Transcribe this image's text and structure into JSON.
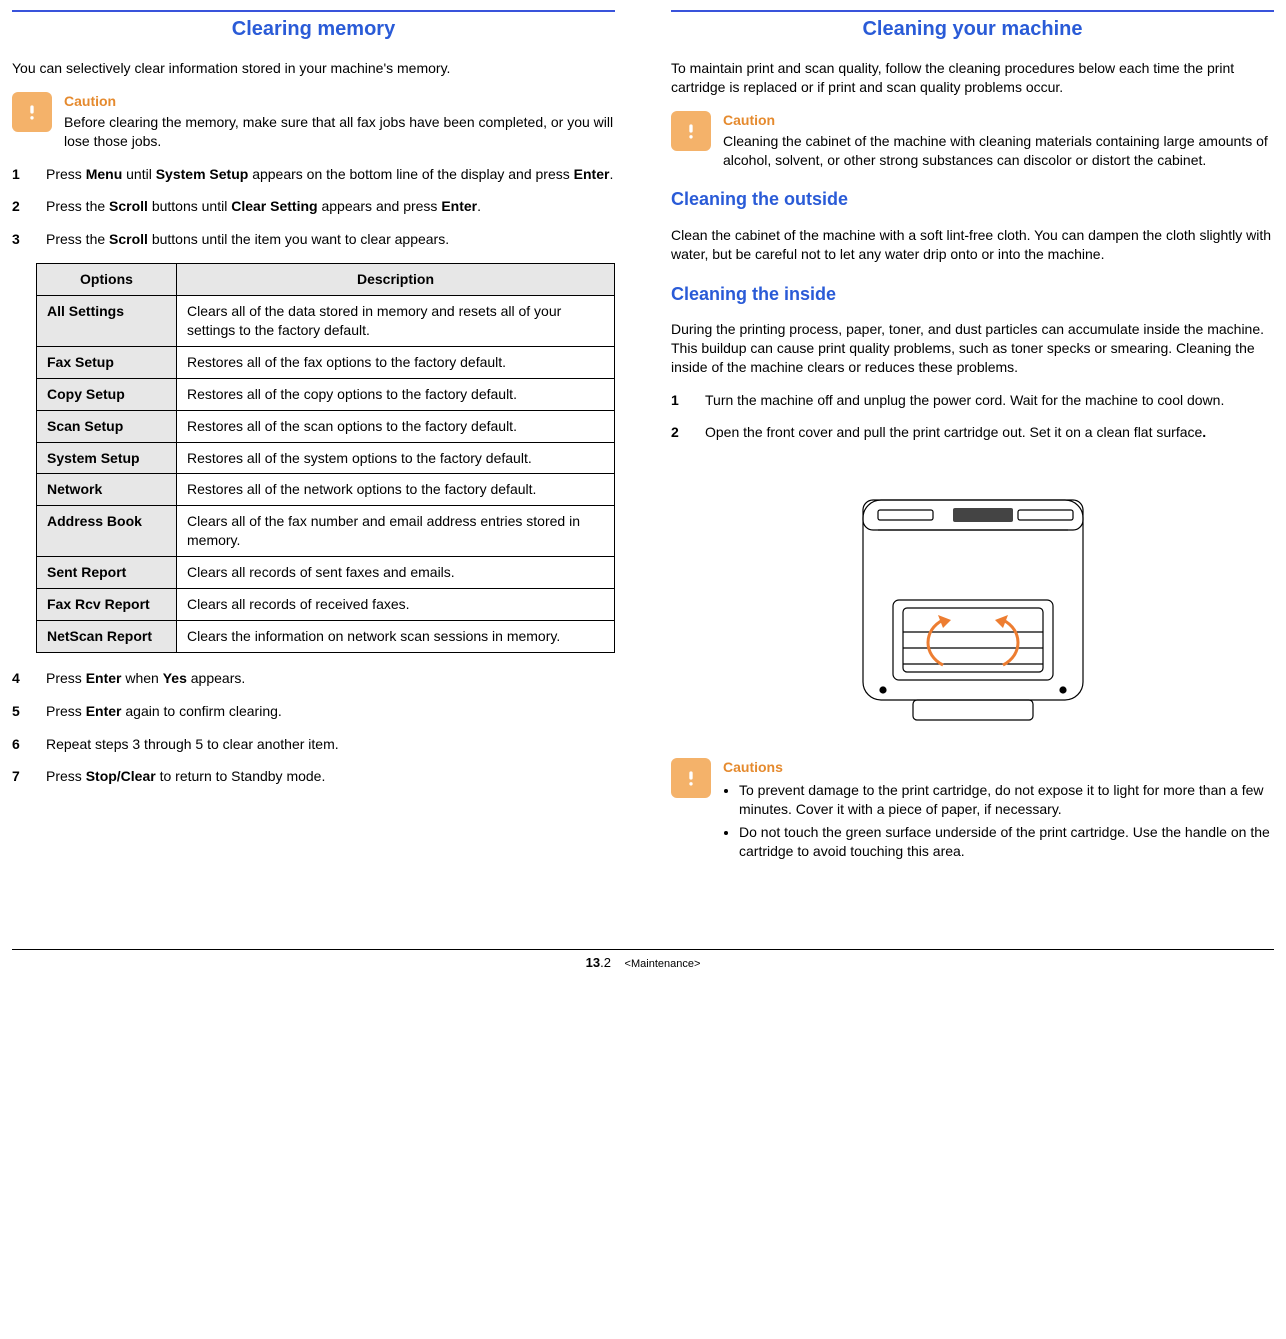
{
  "left": {
    "heading": "Clearing memory",
    "intro": "You can selectively clear information stored in your machine's memory.",
    "caution": {
      "title": "Caution",
      "body": "Before clearing the memory, make sure that all fax jobs have been completed, or you will lose those jobs."
    },
    "step1_a": "Press ",
    "step1_b": "Menu",
    "step1_c": " until ",
    "step1_d": "System Setup",
    "step1_e": " appears on the bottom line of the display and press ",
    "step1_f": "Enter",
    "step1_g": ".",
    "step2_a": "Press the ",
    "step2_b": "Scroll",
    "step2_c": " buttons until ",
    "step2_d": "Clear Setting",
    "step2_e": " appears and press ",
    "step2_f": "Enter",
    "step2_g": ".",
    "step3_a": "Press the ",
    "step3_b": "Scroll",
    "step3_c": " buttons until the item you want to clear appears.",
    "table": {
      "head_opt": "Options",
      "head_desc": "Description",
      "rows": [
        {
          "opt": "All Settings",
          "desc": "Clears all of the data stored in memory and resets all of your settings to the factory default."
        },
        {
          "opt": "Fax Setup",
          "desc": "Restores all of the fax options to the factory default."
        },
        {
          "opt": "Copy Setup",
          "desc": "Restores all of the copy options to the factory default."
        },
        {
          "opt": "Scan Setup",
          "desc": "Restores all of the scan options to the factory default."
        },
        {
          "opt": "System Setup",
          "desc": "Restores all of the system options to the factory default."
        },
        {
          "opt": "Network",
          "desc": "Restores all of the network options to the factory default."
        },
        {
          "opt": "Address Book",
          "desc": "Clears all of the fax number and email address entries stored in memory."
        },
        {
          "opt": "Sent Report",
          "desc": "Clears all records of sent faxes and emails."
        },
        {
          "opt": "Fax Rcv Report",
          "desc": "Clears all records of received faxes."
        },
        {
          "opt": "NetScan Report",
          "desc": "Clears the information on network scan sessions in memory."
        }
      ]
    },
    "step4_a": "Press ",
    "step4_b": "Enter",
    "step4_c": " when ",
    "step4_d": "Yes",
    "step4_e": " appears.",
    "step5_a": "Press ",
    "step5_b": "Enter",
    "step5_c": " again to confirm clearing.",
    "step6": "Repeat steps 3 through 5 to clear another item.",
    "step7_a": "Press ",
    "step7_b": "Stop/Clear",
    "step7_c": " to return to Standby mode."
  },
  "right": {
    "heading": "Cleaning your machine",
    "intro": "To maintain print and scan quality, follow the cleaning procedures below each time the print cartridge is replaced or if print and scan quality problems occur.",
    "caution": {
      "title": "Caution",
      "body": "Cleaning the cabinet of the machine with cleaning materials containing large amounts of alcohol, solvent, or other strong substances can discolor or distort the cabinet."
    },
    "outside_head": "Cleaning the outside",
    "outside_body": "Clean the cabinet of the machine with a soft lint-free cloth. You can dampen the cloth slightly with water, but be careful not to let any water drip onto or into the machine.",
    "inside_head": "Cleaning the inside",
    "inside_body": "During the printing process, paper, toner, and dust particles can accumulate inside the machine. This buildup can cause print quality problems, such as toner specks or smearing. Cleaning the inside of the machine clears or reduces these problems.",
    "step1": "Turn the machine off and unplug the power cord. Wait for the machine to cool down.",
    "step2_a": "Open the front cover and pull the print cartridge out. Set it on a clean flat surface",
    "step2_b": ".",
    "cautions2": {
      "title": "Cautions",
      "item1": "To prevent damage to the print cartridge, do not expose it to light for more than a few minutes. Cover it with a piece of paper, if necessary.",
      "item2": "Do not touch the green surface underside of the print cartridge. Use the handle on the cartridge to avoid touching this area."
    }
  },
  "footer": {
    "chapter": "13",
    "page": ".2",
    "section": "<Maintenance>"
  }
}
